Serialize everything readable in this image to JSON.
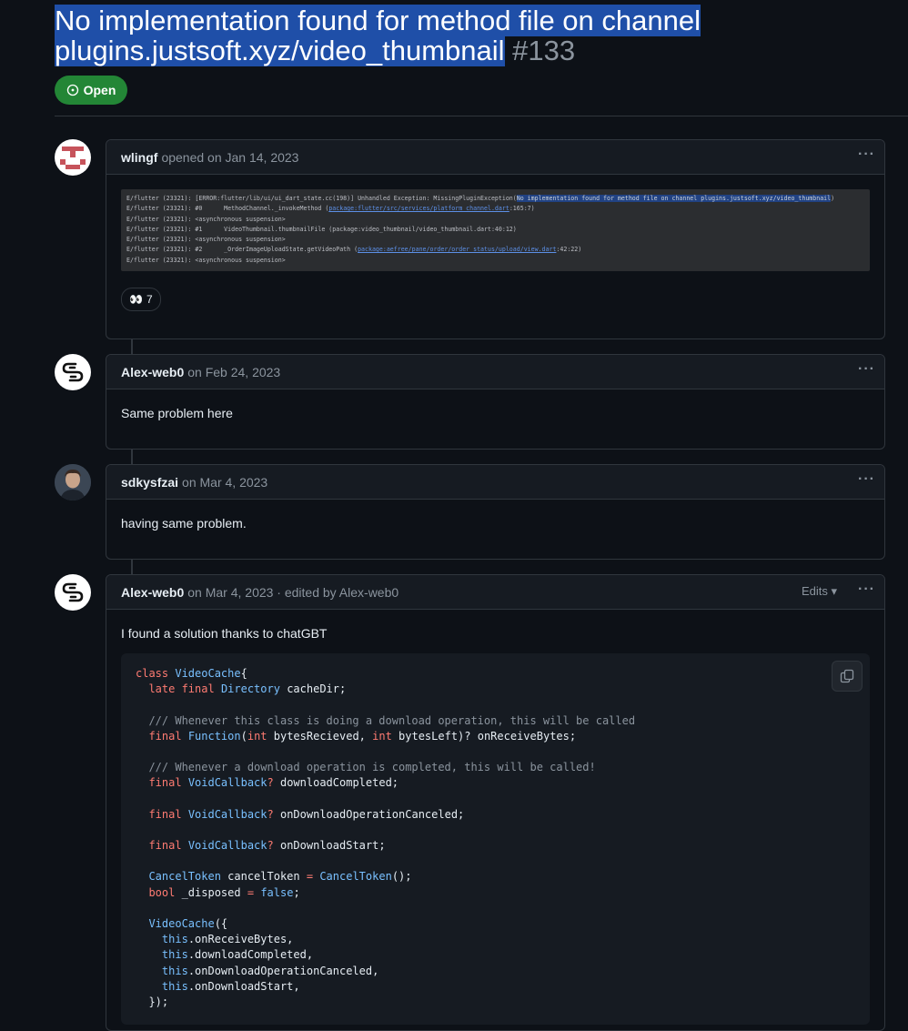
{
  "issue": {
    "title": "No implementation found for method file on channel plugins.justsoft.xyz/video_thumbnail",
    "number": "#133",
    "state": "Open"
  },
  "comments": [
    {
      "author": "wlingf",
      "meta": "opened on Jan 14, 2023",
      "log_lines": [
        "E/flutter (23321): [ERROR:flutter/lib/ui/ui_dart_state.cc(198)] Unhandled Exception: MissingPluginException(",
        "No implementation found for method file on channel plugins.justsoft.xyz/video_thumbnail",
        "E/flutter (23321): #0      MethodChannel._invokeMethod (",
        "package:flutter/src/services/platform_channel.dart",
        ":165:7)",
        "E/flutter (23321): <asynchronous suspension>",
        "E/flutter (23321): #1      VideoThumbnail.thumbnailFile (package:video_thumbnail/video_thumbnail.dart:40:12)",
        "E/flutter (23321): <asynchronous suspension>",
        "E/flutter (23321): #2      _OrderImageUploadState.getVideoPath (",
        "package:aefree/pane/order/order_status/upload/view.dart",
        ":42:22)",
        "E/flutter (23321): <asynchronous suspension>"
      ],
      "reaction_emoji": "👀",
      "reaction_count": "7"
    },
    {
      "author": "Alex-web0",
      "meta": "on Feb 24, 2023",
      "body": "Same problem here"
    },
    {
      "author": "sdkysfzai",
      "meta": "on Mar 4, 2023",
      "body": "having same problem."
    },
    {
      "author": "Alex-web0",
      "meta": "on Mar 4, 2023 · edited by Alex-web0",
      "edits_label": "Edits",
      "body": "I found a solution thanks to chatGBT"
    }
  ],
  "code": [
    [
      [
        "kw",
        "class "
      ],
      [
        "ty",
        "VideoCache"
      ],
      [
        "",
        "{"
      ]
    ],
    [
      [
        "",
        "  "
      ],
      [
        "kw",
        "late final "
      ],
      [
        "ty",
        "Directory"
      ],
      [
        "",
        " cacheDir;"
      ]
    ],
    [],
    [
      [
        "cm",
        "  /// Whenever this class is doing a download operation, this will be called"
      ]
    ],
    [
      [
        "",
        "  "
      ],
      [
        "kw",
        "final "
      ],
      [
        "ty",
        "Function"
      ],
      [
        "",
        "("
      ],
      [
        "kw",
        "int"
      ],
      [
        "",
        " bytesRecieved, "
      ],
      [
        "kw",
        "int"
      ],
      [
        "",
        " bytesLeft)? onReceiveBytes;"
      ]
    ],
    [],
    [
      [
        "cm",
        "  /// Whenever a download operation is completed, this will be called!"
      ]
    ],
    [
      [
        "",
        "  "
      ],
      [
        "kw",
        "final "
      ],
      [
        "ty",
        "VoidCallback"
      ],
      [
        "kw",
        "?"
      ],
      [
        "",
        " downloadCompleted;"
      ]
    ],
    [],
    [
      [
        "",
        "  "
      ],
      [
        "kw",
        "final "
      ],
      [
        "ty",
        "VoidCallback"
      ],
      [
        "kw",
        "?"
      ],
      [
        "",
        " onDownloadOperationCanceled;"
      ]
    ],
    [],
    [
      [
        "",
        "  "
      ],
      [
        "kw",
        "final "
      ],
      [
        "ty",
        "VoidCallback"
      ],
      [
        "kw",
        "?"
      ],
      [
        "",
        " onDownloadStart;"
      ]
    ],
    [],
    [
      [
        "",
        "  "
      ],
      [
        "ty",
        "CancelToken"
      ],
      [
        "",
        " cancelToken "
      ],
      [
        "kw",
        "="
      ],
      [
        "",
        " "
      ],
      [
        "ty",
        "CancelToken"
      ],
      [
        "",
        "();"
      ]
    ],
    [
      [
        "",
        "  "
      ],
      [
        "kw",
        "bool"
      ],
      [
        "",
        " _disposed "
      ],
      [
        "kw",
        "="
      ],
      [
        "",
        " "
      ],
      [
        "ty",
        "false"
      ],
      [
        "",
        ";"
      ]
    ],
    [],
    [
      [
        "",
        "  "
      ],
      [
        "ty",
        "VideoCache"
      ],
      [
        "",
        "({"
      ]
    ],
    [
      [
        "",
        "    "
      ],
      [
        "ty",
        "this"
      ],
      [
        "",
        ".onReceiveBytes,"
      ]
    ],
    [
      [
        "",
        "    "
      ],
      [
        "ty",
        "this"
      ],
      [
        "",
        ".downloadCompleted,"
      ]
    ],
    [
      [
        "",
        "    "
      ],
      [
        "ty",
        "this"
      ],
      [
        "",
        ".onDownloadOperationCanceled,"
      ]
    ],
    [
      [
        "",
        "    "
      ],
      [
        "ty",
        "this"
      ],
      [
        "",
        ".onDownloadStart,"
      ]
    ],
    [
      [
        "",
        "  });"
      ]
    ]
  ]
}
